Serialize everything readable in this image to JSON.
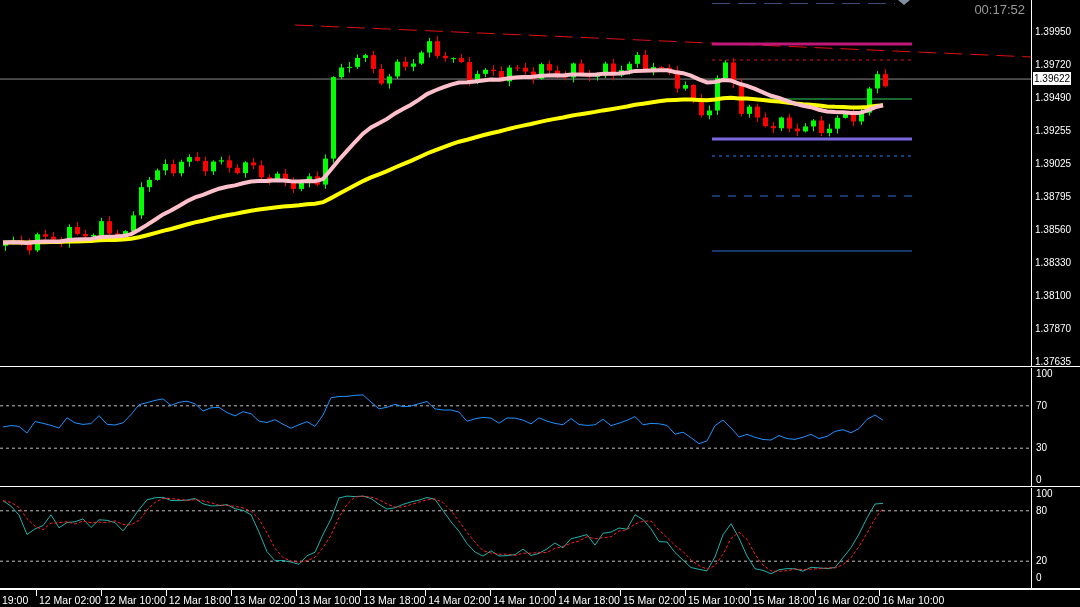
{
  "timer": "00:17:52",
  "price_axis": [
    "1.39950",
    "1.39720",
    "1.39490",
    "1.39255",
    "1.39025",
    "1.38795",
    "1.38560",
    "1.38330",
    "1.38100",
    "1.37870",
    "1.37635"
  ],
  "current_price": "1.39622",
  "rsi_axis": [
    "100",
    "70",
    "30",
    "0"
  ],
  "stochastic_axis": [
    "100",
    "80",
    "20",
    "0"
  ],
  "time_axis": [
    "19:00",
    "12 Mar 02:00",
    "12 Mar 10:00",
    "12 Mar 18:00",
    "13 Mar 02:00",
    "13 Mar 10:00",
    "13 Mar 18:00",
    "14 Mar 02:00",
    "14 Mar 10:00",
    "14 Mar 18:00",
    "15 Mar 02:00",
    "15 Mar 10:00",
    "15 Mar 18:00",
    "16 Mar 02:00",
    "16 Mar 10:00"
  ]
}
